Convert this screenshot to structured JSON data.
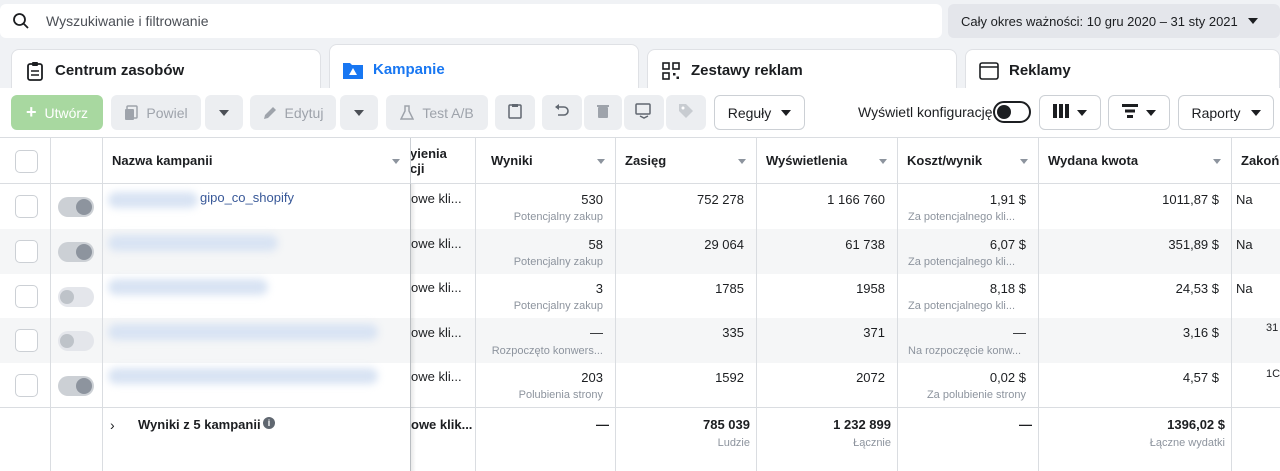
{
  "search": {
    "placeholder": "Wyszukiwanie i filtrowanie"
  },
  "date_range": {
    "label": "Cały okres ważności: 10 gru 2020 – 31 sty 2021"
  },
  "tabs": [
    {
      "label": "Centrum zasobów",
      "icon": "clipboard-icon",
      "active": false
    },
    {
      "label": "Kampanie",
      "icon": "campaign-folder-icon",
      "active": true
    },
    {
      "label": "Zestawy reklam",
      "icon": "grid-icon",
      "active": false
    },
    {
      "label": "Reklamy",
      "icon": "ad-window-icon",
      "active": false
    }
  ],
  "toolbar": {
    "create": "Utwórz",
    "duplicate": "Powiel",
    "edit": "Edytuj",
    "ab_test": "Test A/B",
    "rules": "Reguły",
    "show_settings": "Wyświetl konfigurację",
    "reports": "Raporty"
  },
  "columns": {
    "name": "Nazwa kampanii",
    "objective_top": "yienia",
    "objective_bottom": "cji",
    "results": "Wyniki",
    "reach": "Zasięg",
    "impressions": "Wyświetlenia",
    "cost": "Koszt/wynik",
    "spend": "Wydana kwota",
    "end": "Zakoń"
  },
  "rows": [
    {
      "name": "gipo_co_shopify",
      "objective": "owe kli...",
      "results": "530",
      "results_sub": "Potencjalny zakup",
      "reach": "752 278",
      "impressions": "1 166 760",
      "cost": "1,91 $",
      "cost_sub": "Za potencjalnego kli...",
      "spend": "1011,87 $",
      "end": "Na",
      "on": true
    },
    {
      "name": "",
      "objective": "owe kli...",
      "results": "58",
      "results_sub": "Potencjalny zakup",
      "reach": "29 064",
      "impressions": "61 738",
      "cost": "6,07 $",
      "cost_sub": "Za potencjalnego kli...",
      "spend": "351,89 $",
      "end": "Na",
      "on": true
    },
    {
      "name": "",
      "objective": "owe kli...",
      "results": "3",
      "results_sub": "Potencjalny zakup",
      "reach": "1785",
      "impressions": "1958",
      "cost": "8,18 $",
      "cost_sub": "Za potencjalnego kli...",
      "spend": "24,53 $",
      "end": "Na",
      "on": false
    },
    {
      "name": "",
      "objective": "owe kli...",
      "results": "—",
      "results_sub": "Rozpoczęto konwers...",
      "reach": "335",
      "impressions": "371",
      "cost": "—",
      "cost_sub": "Na rozpoczęcie konw...",
      "spend": "3,16 $",
      "end": "31",
      "on": false
    },
    {
      "name": "",
      "objective": "owe kli...",
      "results": "203",
      "results_sub": "Polubienia strony",
      "reach": "1592",
      "impressions": "2072",
      "cost": "0,02 $",
      "cost_sub": "Za polubienie strony",
      "spend": "4,57 $",
      "end": "1C",
      "on": true
    }
  ],
  "summary": {
    "label": "Wyniki z 5 kampanii",
    "objective": "owe klik...",
    "results": "—",
    "reach": "785 039",
    "reach_sub": "Ludzie",
    "impressions": "1 232 899",
    "impressions_sub": "Łącznie",
    "cost": "—",
    "spend": "1396,02 $",
    "spend_sub": "Łączne wydatki"
  }
}
